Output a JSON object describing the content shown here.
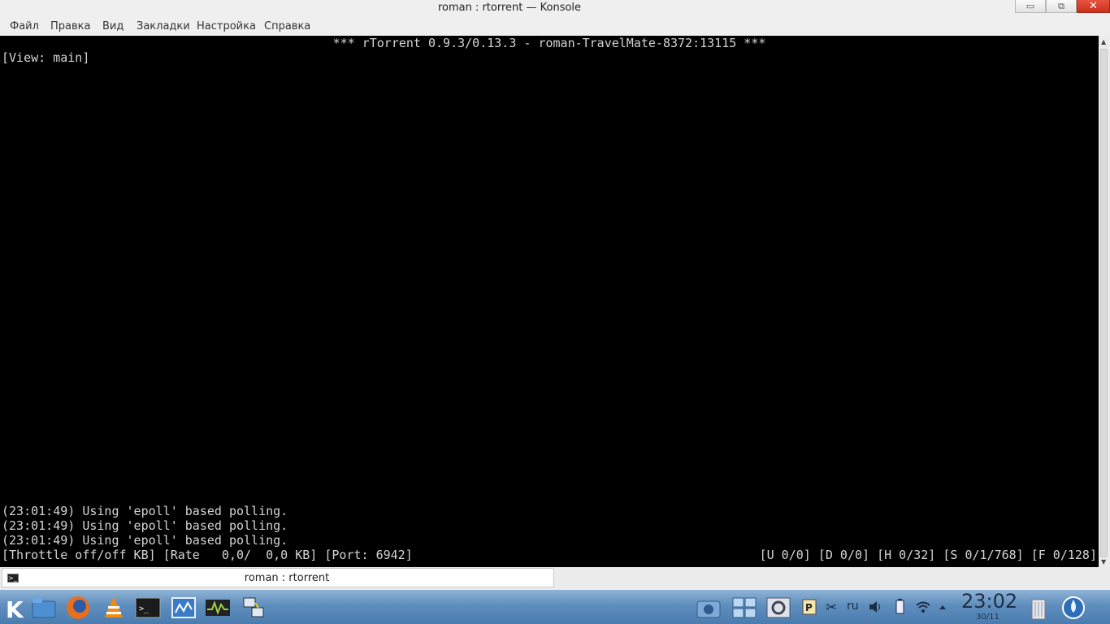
{
  "window": {
    "title": "roman : rtorrent — Konsole",
    "controls": {
      "minimize": "▭",
      "maximize": "⧉",
      "close": "✕"
    }
  },
  "menubar": {
    "items": [
      "Файл",
      "Правка",
      "Вид",
      "Закладки",
      "Настройка",
      "Справка"
    ]
  },
  "terminal": {
    "header": "*** rTorrent 0.9.3/0.13.3 - roman-TravelMate-8372:13115 ***",
    "view": "[View: main]",
    "log": [
      "(23:01:49) Using 'epoll' based polling.",
      "(23:01:49) Using 'epoll' based polling.",
      "(23:01:49) Using 'epoll' based polling."
    ],
    "status_left": "[Throttle off/off KB] [Rate   0,0/  0,0 KB] [Port: 6942]",
    "status_right": "[U 0/0] [D 0/0] [H 0/32] [S 0/1/768] [F 0/128]",
    "colors": {
      "background": "#000000",
      "foreground": "#d4d4d4"
    }
  },
  "tab": {
    "label": "roman : rtorrent",
    "icon": "terminal-icon"
  },
  "taskbar": {
    "launchers": [
      "kde-menu-icon",
      "file-manager-icon",
      "firefox-icon",
      "vlc-icon",
      "konsole-icon",
      "system-monitor-icon",
      "ksysguard-icon",
      "network-icon"
    ],
    "tray": [
      "camera-icon",
      "windows-icon",
      "settings-icon",
      "klipper-icon",
      "scissors-icon",
      "keyboard-layout",
      "volume-icon",
      "battery-icon",
      "wifi-icon",
      "tray-expand-icon",
      "trash-icon",
      "weather-icon"
    ],
    "keyboard_layout": "ru",
    "clock": {
      "time": "23:02",
      "date": "30/11"
    }
  }
}
